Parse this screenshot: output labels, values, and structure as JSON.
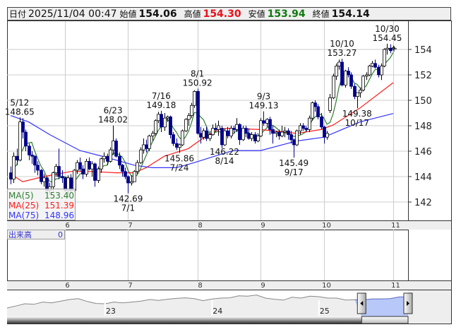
{
  "header": {
    "date_label": "日付",
    "datetime": "2025/11/04 00:47",
    "open_label": "始値",
    "open": "154.06",
    "high_label": "高値",
    "high": "154.30",
    "low_label": "安値",
    "low": "153.94",
    "close_label": "終値",
    "close": "154.14"
  },
  "legend": [
    {
      "label": "MA(5)",
      "value": "153.40",
      "color": "#2e7d32"
    },
    {
      "label": "MA(25)",
      "value": "151.39",
      "color": "#ff1a1a"
    },
    {
      "label": "MA(75)",
      "value": "148.96",
      "color": "#3333ff"
    }
  ],
  "volume": {
    "label": "出来高",
    "value": "0"
  },
  "chart_data": {
    "type": "candlestick",
    "ylim": [
      140.7,
      155.8
    ],
    "y_ticks": [
      "142",
      "144",
      "146",
      "148",
      "150",
      "152",
      "154"
    ],
    "grid": true,
    "colors": {
      "up_fill": "#ffffff",
      "up_stroke": "#000000",
      "down": "#00008b",
      "ma5": "#2e7d32",
      "ma25": "#ff1a1a",
      "ma75": "#3333ff"
    },
    "month_ticks": [
      {
        "label": "6",
        "index": 18
      },
      {
        "label": "7",
        "index": 39
      },
      {
        "label": "8",
        "index": 62
      },
      {
        "label": "9",
        "index": 83
      },
      {
        "label": "10",
        "index": 104
      },
      {
        "label": "11",
        "index": 127
      }
    ],
    "candles": [
      [
        144.3,
        144.8,
        143.4,
        143.8
      ],
      [
        143.8,
        145.9,
        143.5,
        145.6
      ],
      [
        145.6,
        146.2,
        144.9,
        145.3
      ],
      [
        145.3,
        148.65,
        145.2,
        148.3
      ],
      [
        148.3,
        148.6,
        147.0,
        147.5
      ],
      [
        147.5,
        147.7,
        146.0,
        146.4
      ],
      [
        146.4,
        146.6,
        145.3,
        145.7
      ],
      [
        145.7,
        146.0,
        145.0,
        145.6
      ],
      [
        145.6,
        145.7,
        144.3,
        144.9
      ],
      [
        144.9,
        145.2,
        144.1,
        144.5
      ],
      [
        144.5,
        144.6,
        143.4,
        143.6
      ],
      [
        143.6,
        144.2,
        143.2,
        143.9
      ],
      [
        143.9,
        144.0,
        142.8,
        142.9
      ],
      [
        142.9,
        143.5,
        142.6,
        143.2
      ],
      [
        143.2,
        144.4,
        142.8,
        144.3
      ],
      [
        144.3,
        145.0,
        144.0,
        144.8
      ],
      [
        144.8,
        146.2,
        143.8,
        144.0
      ],
      [
        144.0,
        144.5,
        143.5,
        143.9
      ],
      [
        143.9,
        144.0,
        142.8,
        142.9
      ],
      [
        142.9,
        144.1,
        142.4,
        143.9
      ],
      [
        143.9,
        144.2,
        142.8,
        142.9
      ],
      [
        142.9,
        144.6,
        142.8,
        144.5
      ],
      [
        144.5,
        145.3,
        144.2,
        145.1
      ],
      [
        145.1,
        145.5,
        144.4,
        144.6
      ],
      [
        144.6,
        144.9,
        143.8,
        144.2
      ],
      [
        144.2,
        145.4,
        144.0,
        145.2
      ],
      [
        145.2,
        145.5,
        144.5,
        144.6
      ],
      [
        144.6,
        145.2,
        144.0,
        145.0
      ],
      [
        145.0,
        145.1,
        143.2,
        143.7
      ],
      [
        143.7,
        144.8,
        143.5,
        144.6
      ],
      [
        144.6,
        145.5,
        144.3,
        145.4
      ],
      [
        145.4,
        145.9,
        145.1,
        145.6
      ],
      [
        145.6,
        145.8,
        144.9,
        145.2
      ],
      [
        145.2,
        146.3,
        145.1,
        146.1
      ],
      [
        146.1,
        148.02,
        145.7,
        146.8
      ],
      [
        146.8,
        147.0,
        145.5,
        145.6
      ],
      [
        145.6,
        145.9,
        144.6,
        144.9
      ],
      [
        144.9,
        145.0,
        144.0,
        144.4
      ],
      [
        144.4,
        144.7,
        143.8,
        144.0
      ],
      [
        144.0,
        144.1,
        142.69,
        143.5
      ],
      [
        143.5,
        144.1,
        143.3,
        143.6
      ],
      [
        143.6,
        144.5,
        143.6,
        144.4
      ],
      [
        144.4,
        145.3,
        144.2,
        145.1
      ],
      [
        145.1,
        146.3,
        145.0,
        146.1
      ],
      [
        146.1,
        147.0,
        145.8,
        146.5
      ],
      [
        146.5,
        146.9,
        145.9,
        146.2
      ],
      [
        146.2,
        147.3,
        146.0,
        147.2
      ],
      [
        147.2,
        147.6,
        146.8,
        147.4
      ],
      [
        147.4,
        148.5,
        147.2,
        148.4
      ],
      [
        148.4,
        149.1,
        148.2,
        148.9
      ],
      [
        148.9,
        149.18,
        147.5,
        147.9
      ],
      [
        147.9,
        149.0,
        147.6,
        148.6
      ],
      [
        148.6,
        148.8,
        148.3,
        148.7
      ],
      [
        148.7,
        148.8,
        147.0,
        147.3
      ],
      [
        147.3,
        147.5,
        146.4,
        146.6
      ],
      [
        146.6,
        147.0,
        146.1,
        146.3
      ],
      [
        146.3,
        146.6,
        145.86,
        146.5
      ],
      [
        146.5,
        147.7,
        146.4,
        147.6
      ],
      [
        147.6,
        148.6,
        147.5,
        148.5
      ],
      [
        148.5,
        149.0,
        148.0,
        148.8
      ],
      [
        148.8,
        149.8,
        148.6,
        149.6
      ],
      [
        149.6,
        150.8,
        149.4,
        150.7
      ],
      [
        150.7,
        150.92,
        147.3,
        147.4
      ],
      [
        147.4,
        147.9,
        146.6,
        147.1
      ],
      [
        147.1,
        147.8,
        146.9,
        147.6
      ],
      [
        147.6,
        147.9,
        146.8,
        147.0
      ],
      [
        147.0,
        147.6,
        146.8,
        147.3
      ],
      [
        147.3,
        148.1,
        147.2,
        147.8
      ],
      [
        147.8,
        148.2,
        147.5,
        147.7
      ],
      [
        147.7,
        148.4,
        147.2,
        148.0
      ],
      [
        147.8,
        148.0,
        146.22,
        146.5
      ],
      [
        146.5,
        147.8,
        146.4,
        147.6
      ],
      [
        147.6,
        147.9,
        147.0,
        147.2
      ],
      [
        147.2,
        148.0,
        147.0,
        147.8
      ],
      [
        147.8,
        148.0,
        147.4,
        147.7
      ],
      [
        147.7,
        148.6,
        147.5,
        148.1
      ],
      [
        148.1,
        148.2,
        146.5,
        146.9
      ],
      [
        146.9,
        148.0,
        146.8,
        147.8
      ],
      [
        147.8,
        148.0,
        147.1,
        147.4
      ],
      [
        147.4,
        147.8,
        146.9,
        147.0
      ],
      [
        147.0,
        147.5,
        146.8,
        147.3
      ],
      [
        147.3,
        147.5,
        146.6,
        146.8
      ],
      [
        146.8,
        147.4,
        146.7,
        147.2
      ],
      [
        147.2,
        148.6,
        147.1,
        148.4
      ],
      [
        148.4,
        149.13,
        148.0,
        148.2
      ],
      [
        148.2,
        148.6,
        147.9,
        148.5
      ],
      [
        148.5,
        148.7,
        147.3,
        147.7
      ],
      [
        147.7,
        148.0,
        146.6,
        147.4
      ],
      [
        147.4,
        147.6,
        147.1,
        147.5
      ],
      [
        147.5,
        147.7,
        146.9,
        147.2
      ],
      [
        147.2,
        148.0,
        147.1,
        147.5
      ],
      [
        147.5,
        147.9,
        147.1,
        147.6
      ],
      [
        147.6,
        147.8,
        146.9,
        147.3
      ],
      [
        147.3,
        147.6,
        146.6,
        146.9
      ],
      [
        146.9,
        147.0,
        145.49,
        146.5
      ],
      [
        146.5,
        147.7,
        146.4,
        147.6
      ],
      [
        147.6,
        148.2,
        147.3,
        148.0
      ],
      [
        148.0,
        148.2,
        147.6,
        147.8
      ],
      [
        147.8,
        148.0,
        147.5,
        147.7
      ],
      [
        147.7,
        148.8,
        147.5,
        148.6
      ],
      [
        148.6,
        149.9,
        148.4,
        149.8
      ],
      [
        149.8,
        150.0,
        149.1,
        149.5
      ],
      [
        149.5,
        149.7,
        148.5,
        148.7
      ],
      [
        148.7,
        149.0,
        147.7,
        147.9
      ],
      [
        147.9,
        148.0,
        146.6,
        147.1
      ],
      [
        147.1,
        147.6,
        146.9,
        147.4
      ],
      [
        149.2,
        150.5,
        149.0,
        150.2
      ],
      [
        150.2,
        152.1,
        150.1,
        151.9
      ],
      [
        151.9,
        152.9,
        151.6,
        152.7
      ],
      [
        152.7,
        153.2,
        152.4,
        153.0
      ],
      [
        153.0,
        153.27,
        151.1,
        151.2
      ],
      [
        151.2,
        152.4,
        151.0,
        152.3
      ],
      [
        152.3,
        152.6,
        151.8,
        152.0
      ],
      [
        152.0,
        152.2,
        150.9,
        151.1
      ],
      [
        151.1,
        151.3,
        150.1,
        150.3
      ],
      [
        150.3,
        150.6,
        149.38,
        150.6
      ],
      [
        150.6,
        151.0,
        150.2,
        150.8
      ],
      [
        150.8,
        152.0,
        150.7,
        151.9
      ],
      [
        151.9,
        152.2,
        151.6,
        152.0
      ],
      [
        152.0,
        152.8,
        151.9,
        152.7
      ],
      [
        152.7,
        153.1,
        152.6,
        152.9
      ],
      [
        152.9,
        153.2,
        152.5,
        152.6
      ],
      [
        152.6,
        152.8,
        151.8,
        152.0
      ],
      [
        152.0,
        152.9,
        151.6,
        152.7
      ],
      [
        152.7,
        154.1,
        152.6,
        154.0
      ],
      [
        154.0,
        154.45,
        153.6,
        154.1
      ],
      [
        154.1,
        154.4,
        153.7,
        153.9
      ],
      [
        154.06,
        154.3,
        153.94,
        154.14
      ]
    ],
    "ma25_points": [
      [
        0,
        144.2
      ],
      [
        4,
        143.6
      ],
      [
        11,
        144.0
      ],
      [
        20,
        144.4
      ],
      [
        27,
        144.4
      ],
      [
        35,
        144.3
      ],
      [
        41,
        144.3
      ],
      [
        45,
        144.7
      ],
      [
        51,
        145.6
      ],
      [
        59,
        146.2
      ],
      [
        64,
        147.05
      ],
      [
        69,
        147.7
      ],
      [
        72,
        147.8
      ],
      [
        83,
        147.7
      ],
      [
        95,
        147.4
      ],
      [
        103,
        147.7
      ],
      [
        107,
        148.05
      ],
      [
        116,
        149.4
      ],
      [
        127,
        151.39
      ]
    ],
    "ma75_points": [
      [
        0,
        148.8
      ],
      [
        6,
        148.3
      ],
      [
        13,
        147.3
      ],
      [
        23,
        146.05
      ],
      [
        32,
        145.5
      ],
      [
        41,
        144.9
      ],
      [
        47,
        144.7
      ],
      [
        55,
        144.7
      ],
      [
        61,
        145.1
      ],
      [
        69,
        145.7
      ],
      [
        74,
        146.05
      ],
      [
        83,
        146.05
      ],
      [
        95,
        146.8
      ],
      [
        104,
        147.1
      ],
      [
        116,
        148.3
      ],
      [
        127,
        148.96
      ]
    ],
    "annotations": [
      {
        "date": "5/12",
        "value": "148.65",
        "index": 3,
        "pos": "above"
      },
      {
        "date": "6/23",
        "value": "148.02",
        "index": 34,
        "pos": "above"
      },
      {
        "date": "7/1",
        "value": "142.69",
        "index": 39,
        "pos": "below"
      },
      {
        "date": "7/16",
        "value": "149.18",
        "index": 50,
        "pos": "above"
      },
      {
        "date": "7/24",
        "value": "145.86",
        "index": 56,
        "pos": "below"
      },
      {
        "date": "8/1",
        "value": "150.92",
        "index": 62,
        "pos": "above"
      },
      {
        "date": "8/14",
        "value": "146.22",
        "index": 71,
        "pos": "below"
      },
      {
        "date": "9/3",
        "value": "149.13",
        "index": 84,
        "pos": "above"
      },
      {
        "date": "9/17",
        "value": "145.49",
        "index": 94,
        "pos": "below"
      },
      {
        "date": "10/10",
        "value": "153.27",
        "index": 110,
        "pos": "above"
      },
      {
        "date": "10/17",
        "value": "149.38",
        "index": 115,
        "pos": "below"
      },
      {
        "date": "10/30",
        "value": "154.45",
        "index": 125,
        "pos": "above"
      }
    ],
    "navigator": {
      "values": [
        115,
        122,
        130,
        128,
        136,
        133,
        139,
        145,
        148,
        138,
        131,
        130,
        136,
        133,
        136,
        139,
        145,
        142,
        146,
        149,
        151,
        148,
        141,
        147,
        150,
        151,
        158,
        157,
        161,
        150,
        146,
        143,
        153,
        150,
        157,
        155,
        150,
        150,
        143,
        144,
        144,
        147,
        147,
        148,
        154,
        154
      ],
      "year_labels": [
        {
          "label": "23",
          "index": 11
        },
        {
          "label": "24",
          "index": 23
        },
        {
          "label": "25",
          "index": 35
        }
      ],
      "selection_start_index": 39
    }
  }
}
